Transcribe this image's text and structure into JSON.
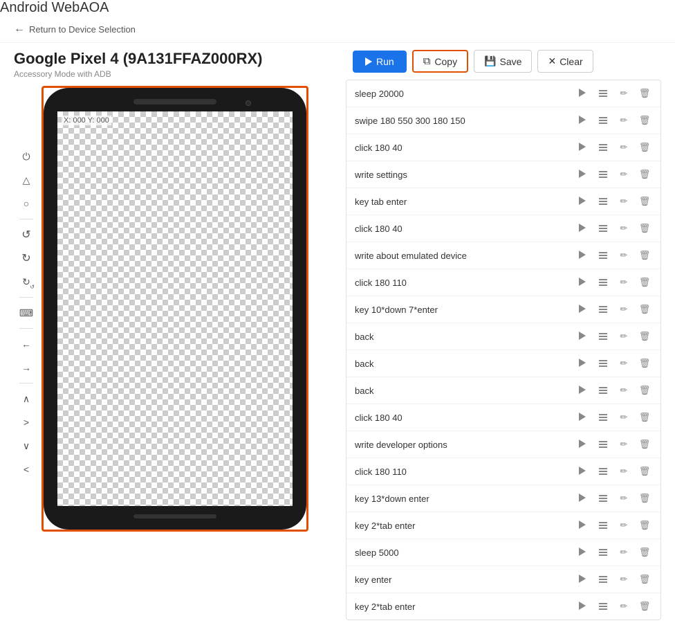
{
  "app": {
    "title": "Android WebAOA"
  },
  "nav": {
    "back_label": "Return to Device Selection"
  },
  "device": {
    "name": "Google Pixel 4 (9A131FFAZ000RX)",
    "mode": "Accessory Mode with ADB",
    "coords": "X: 000 Y: 000"
  },
  "toolbar": {
    "run_label": "Run",
    "copy_label": "Copy",
    "save_label": "Save",
    "clear_label": "Clear"
  },
  "side_controls": [
    {
      "id": "power",
      "icon": "⏻"
    },
    {
      "id": "home",
      "icon": "△"
    },
    {
      "id": "circle",
      "icon": "○"
    },
    {
      "id": "rotate-ccw",
      "icon": "↺"
    },
    {
      "id": "rotate-cw",
      "icon": "↻"
    },
    {
      "id": "rotate-full",
      "icon": "↺"
    },
    {
      "id": "keyboard",
      "icon": "⌨"
    },
    {
      "id": "arrow-left",
      "icon": "←"
    },
    {
      "id": "arrow-right",
      "icon": "→"
    },
    {
      "id": "chevron-up",
      "icon": "∧"
    },
    {
      "id": "chevron-right",
      "icon": ">"
    },
    {
      "id": "chevron-down",
      "icon": "∨"
    },
    {
      "id": "chevron-left",
      "icon": "<"
    }
  ],
  "commands": [
    {
      "text": "sleep 20000"
    },
    {
      "text": "swipe 180 550 300 180 150"
    },
    {
      "text": "click 180 40"
    },
    {
      "text": "write settings"
    },
    {
      "text": "key tab enter"
    },
    {
      "text": "click 180 40"
    },
    {
      "text": "write about emulated device"
    },
    {
      "text": "click 180 110"
    },
    {
      "text": "key 10*down 7*enter"
    },
    {
      "text": "back"
    },
    {
      "text": "back"
    },
    {
      "text": "back"
    },
    {
      "text": "click 180 40"
    },
    {
      "text": "write developer options"
    },
    {
      "text": "click 180 110"
    },
    {
      "text": "key 13*down enter"
    },
    {
      "text": "key 2*tab enter"
    },
    {
      "text": "sleep 5000"
    },
    {
      "text": "key enter"
    },
    {
      "text": "key 2*tab enter"
    }
  ]
}
